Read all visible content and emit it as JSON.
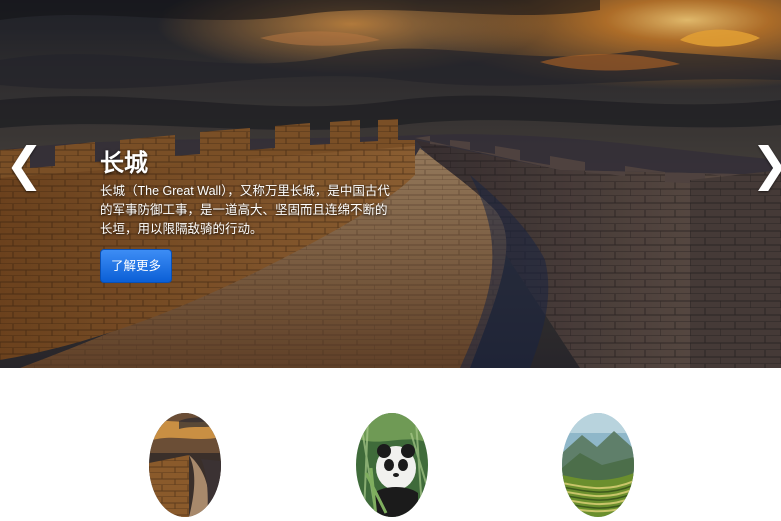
{
  "carousel": {
    "prev_arrow": "❮",
    "next_arrow": "❯",
    "slide": {
      "title": "长城",
      "description": "长城（The Great Wall），又称万里长城，是中国古代的军事防御工事，是一道高大、坚固而且连绵不断的长垣，用以限隔敌骑的行动。",
      "button_label": "了解更多"
    }
  },
  "thumbnails": [
    {
      "subject": "great-wall"
    },
    {
      "subject": "panda"
    },
    {
      "subject": "terraced-fields"
    }
  ],
  "colors": {
    "button": "#0d6efd",
    "caption_text": "#ffffff",
    "page_background": "#ffffff"
  }
}
